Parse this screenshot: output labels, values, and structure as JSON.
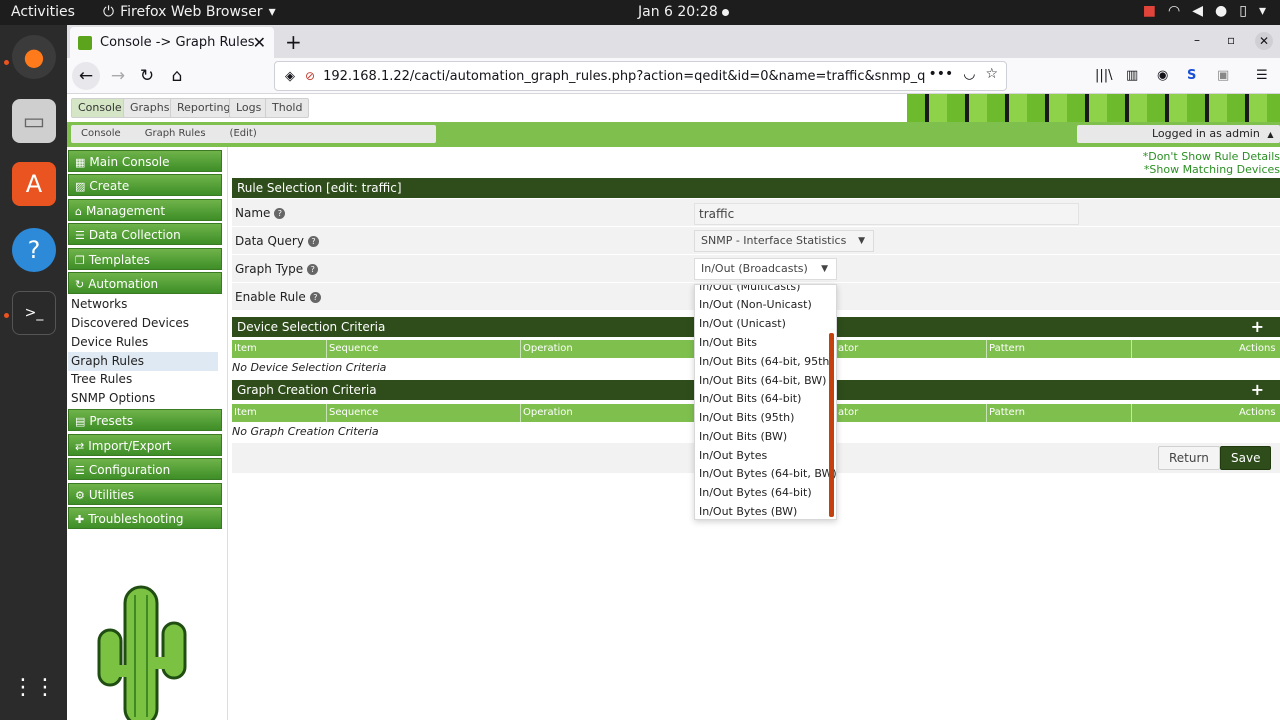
{
  "os": {
    "activities": "Activities",
    "app_menu": "Firefox Web Browser",
    "clock": "Jan 6  20:28"
  },
  "browser": {
    "tab_title": "Console -> Graph Rules",
    "url": "192.168.1.22/cacti/automation_graph_rules.php?action=qedit&id=0&name=traffic&snmp_q"
  },
  "cacti": {
    "top_tabs": [
      "Console",
      "Graphs",
      "Reporting",
      "Logs",
      "Thold"
    ],
    "breadcrumbs": [
      "Console",
      "Graph Rules",
      "(Edit)"
    ],
    "logged_in": "Logged in as admin",
    "nav_headers": [
      "Main Console",
      "Create",
      "Management",
      "Data Collection",
      "Templates",
      "Automation"
    ],
    "automation_items": [
      "Networks",
      "Discovered Devices",
      "Device Rules",
      "Graph Rules",
      "Tree Rules",
      "SNMP Options"
    ],
    "nav_footer": [
      "Presets",
      "Import/Export",
      "Configuration",
      "Utilities",
      "Troubleshooting"
    ],
    "links": {
      "dont_show": "*Don't Show Rule Details",
      "show_matching": "*Show Matching Devices"
    },
    "rule_section": "Rule Selection [edit: traffic]",
    "form": {
      "name_label": "Name",
      "name_value": "traffic",
      "data_query_label": "Data Query",
      "data_query_value": "SNMP - Interface Statistics",
      "graph_type_label": "Graph Type",
      "graph_type_value": "In/Out (Broadcasts)",
      "enable_rule_label": "Enable Rule"
    },
    "device_section": "Device Selection Criteria",
    "graph_section": "Graph Creation Criteria",
    "columns": [
      "Item",
      "Sequence",
      "Operation",
      "ator",
      "Pattern",
      "Actions"
    ],
    "no_device": "No Device Selection Criteria",
    "no_graph": "No Graph Creation Criteria",
    "buttons": {
      "return": "Return",
      "save": "Save"
    },
    "dropdown_options": [
      "In/Out (Multicasts)",
      "In/Out (Non-Unicast)",
      "In/Out (Unicast)",
      "In/Out Bits",
      "In/Out Bits (64-bit, 95th)",
      "In/Out Bits (64-bit, BW)",
      "In/Out Bits (64-bit)",
      "In/Out Bits (95th)",
      "In/Out Bits (BW)",
      "In/Out Bytes",
      "In/Out Bytes (64-bit, BW)",
      "In/Out Bytes (64-bit)",
      "In/Out Bytes (BW)"
    ]
  },
  "colors": {
    "green_header": "#6fb34a",
    "dark_green": "#2e4d1b",
    "light_green": "#7ebf4e"
  }
}
